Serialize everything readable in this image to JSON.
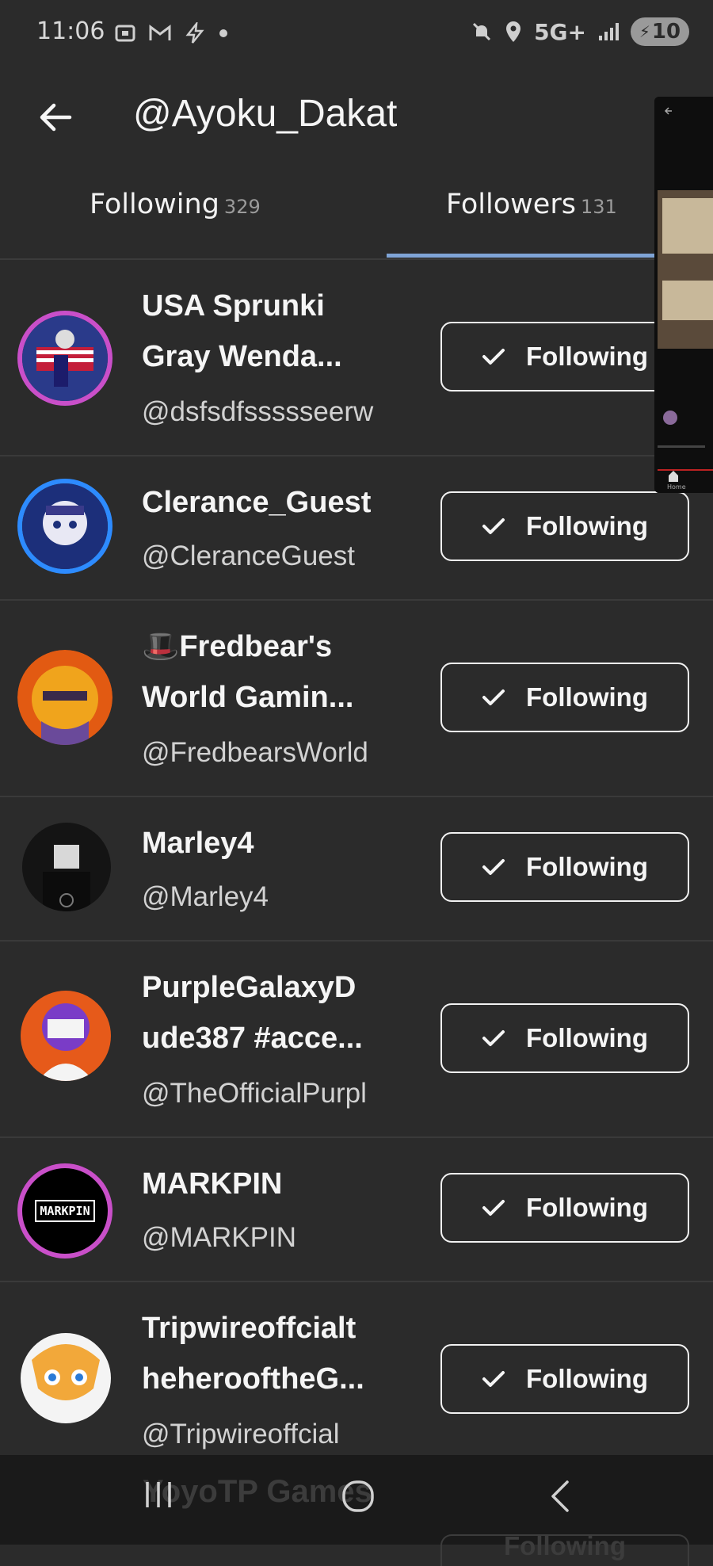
{
  "status_bar": {
    "time": "11:06",
    "left_icons": [
      "screenshot-icon",
      "gmail-icon",
      "bolt-icon",
      "dot-icon"
    ],
    "network": "5G+",
    "battery": "10"
  },
  "header": {
    "title": "@Ayoku_Dakat"
  },
  "tabs": [
    {
      "label": "Following",
      "count": "329",
      "active": false
    },
    {
      "label": "Followers",
      "count": "131",
      "active": true
    }
  ],
  "users": [
    {
      "name_line1": "USA Sprunki",
      "name_line2": "Gray Wenda...",
      "handle": "@dsfsdfssssseerw",
      "button": "Following",
      "avatar_color": "#2a3a8a",
      "ring": "#c94fc9"
    },
    {
      "name_line1": "Clerance_Guest",
      "name_line2": "",
      "handle": "@CleranceGuest",
      "button": "Following",
      "avatar_color": "#1c2f7a",
      "ring": "#2d8bff"
    },
    {
      "name_line1": "🎩Fredbear's",
      "name_line2": "World Gamin...",
      "handle": "@FredbearsWorld",
      "button": "Following",
      "avatar_color": "#f0a41c",
      "ring": "#e25a12"
    },
    {
      "name_line1": "Marley4",
      "name_line2": "",
      "handle": "@Marley4",
      "button": "Following",
      "avatar_color": "#141414",
      "ring": "#2a2a2a"
    },
    {
      "name_line1": "PurpleGalaxyD",
      "name_line2": "ude387 #acce...",
      "handle": "@TheOfficialPurpl",
      "button": "Following",
      "avatar_color": "#e65a1a",
      "ring": "#7a3cc7"
    },
    {
      "name_line1": "MARKPIN",
      "name_line2": "",
      "handle": "@MARKPIN",
      "button": "Following",
      "avatar_color": "#000000",
      "ring": "#c94fc9",
      "avatar_text": "MARKPIN"
    },
    {
      "name_line1": "Tripwireoffcialt",
      "name_line2": "heherooftheG...",
      "handle": "@Tripwireoffcial",
      "button": "Following",
      "avatar_color": "#f6e6b8",
      "ring": "#f0f0f0"
    }
  ],
  "partial_next": {
    "name": "YoyoTP Games",
    "button": "Following"
  },
  "pip_overlay": {
    "label": "Home"
  },
  "nav": [
    "recents-icon",
    "home-icon",
    "back-icon"
  ]
}
